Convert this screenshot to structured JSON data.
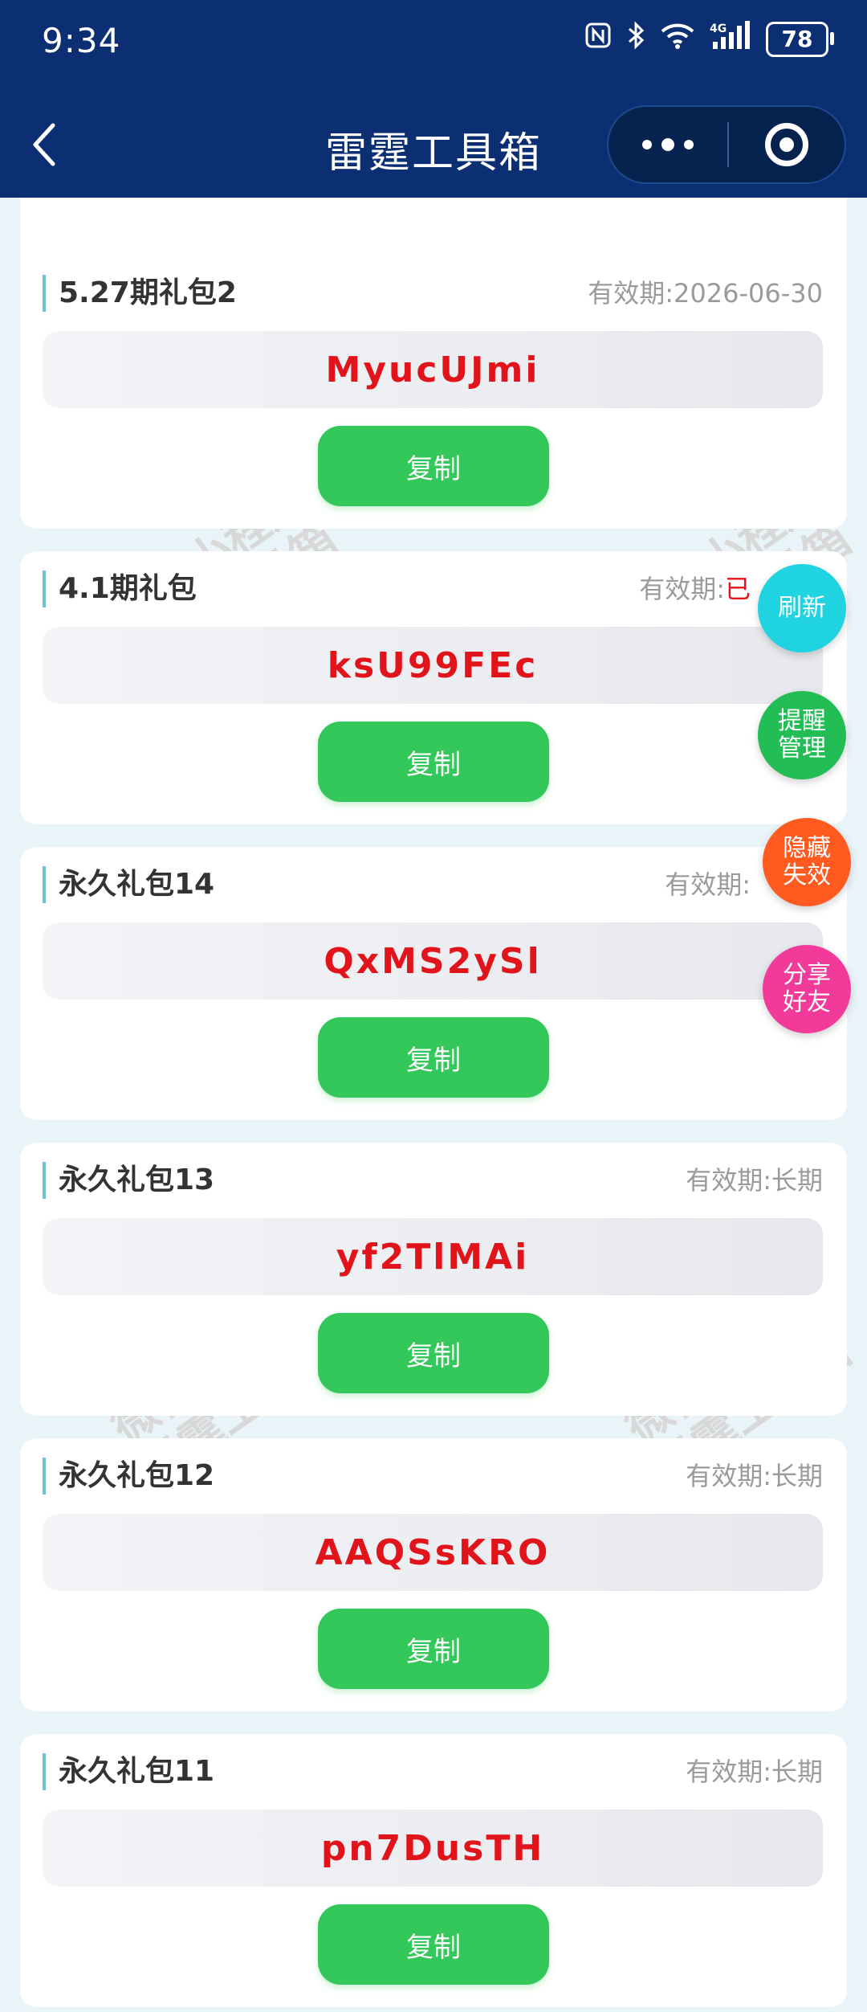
{
  "status_bar": {
    "time": "9:34",
    "battery": "78",
    "icons": [
      "nfc-icon",
      "bluetooth-icon",
      "wifi-icon",
      "signal-4g-icon",
      "battery-icon"
    ]
  },
  "nav": {
    "title": "雷霆工具箱"
  },
  "watermark": {
    "line1": "微信小程序",
    "line2": "雷霆工具箱"
  },
  "copy_label": "复制",
  "cards": [
    {
      "title": "5.27期礼包2",
      "expiry_label": "有效期:",
      "expiry_value": "2026-06-30",
      "code": "MyucUJmi"
    },
    {
      "title": "4.1期礼包",
      "expiry_label": "有效期:",
      "expiry_value": "已",
      "code": "ksU99FEc"
    },
    {
      "title": "永久礼包14",
      "expiry_label": "有效期:",
      "expiry_value": "",
      "code": "QxMS2ySl"
    },
    {
      "title": "永久礼包13",
      "expiry_label": "有效期:",
      "expiry_value": "长期",
      "code": "yf2TlMAi"
    },
    {
      "title": "永久礼包12",
      "expiry_label": "有效期:",
      "expiry_value": "长期",
      "code": "AAQSsKRO"
    },
    {
      "title": "永久礼包11",
      "expiry_label": "有效期:",
      "expiry_value": "长期",
      "code": "pn7DusTH"
    }
  ],
  "floating_buttons": {
    "refresh": "刷新",
    "reminder": "提醒\n管理",
    "hide_invalid": "隐藏\n失效",
    "share": "分享\n好友"
  },
  "colors": {
    "header_bg": "#0b2f72",
    "code_red": "#e1141b",
    "copy_green": "#34c759",
    "refresh_cyan": "#1fd3e0",
    "reminder_green": "#22bd55",
    "hide_orange": "#ff5a1f",
    "share_pink": "#f23a9a"
  }
}
